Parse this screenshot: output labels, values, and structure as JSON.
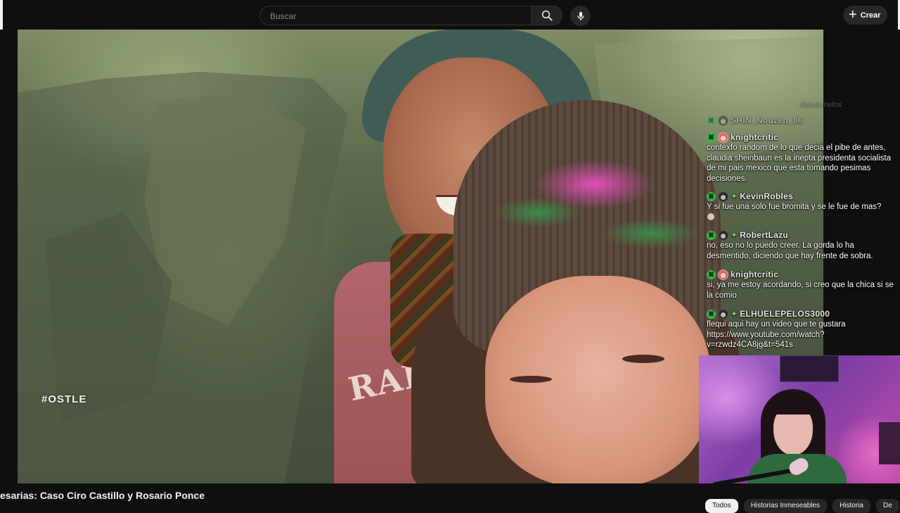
{
  "topbar": {
    "search_placeholder": "Buscar",
    "search_icon": "search-icon",
    "mic_icon": "microphone-icon",
    "create_label": "Crear",
    "create_icon": "plus-icon"
  },
  "video": {
    "overlay_hashtag": "#OSTLE",
    "sweater_text": "RALV"
  },
  "chat": {
    "faded_top": "SHIN_Nouzen_86",
    "faded_fragment": "delvermelos",
    "messages": [
      {
        "user": "knightcritic",
        "text": "contexfo random de lo que decia el pibe de antes, claudia sheinbaun es la inepta presidenta socialista de mi pais mexico que esta tomando pesimas decisiones."
      },
      {
        "user": "KevinRobles",
        "text": "Y si fue una solo fue bromita y se le fue de mas?"
      },
      {
        "user": "RobertLazu",
        "text": "no, eso no lo puedo creer. La gorda lo ha desmentido, diciendo que hay frente de sobra."
      },
      {
        "user": "knightcritic",
        "text": "si, ya me estoy acordando, si creo que la chica si se la comio"
      },
      {
        "user": "ELHUELEPELOS3000",
        "text": "flequi aqui hay un video que te gustara https://www.youtube.com/watch?v=rzwdz4CA8jg&t=541s"
      }
    ]
  },
  "bottom": {
    "video_title": "esarias: Caso Ciro Castillo y Rosario Ponce",
    "chips": [
      "Todos",
      "Historias Inmeseables",
      "Historia",
      "De"
    ]
  },
  "colors": {
    "background": "#0f0f0f",
    "mod_badge": "#36c24a",
    "chip_active": "#f1f1f1"
  }
}
